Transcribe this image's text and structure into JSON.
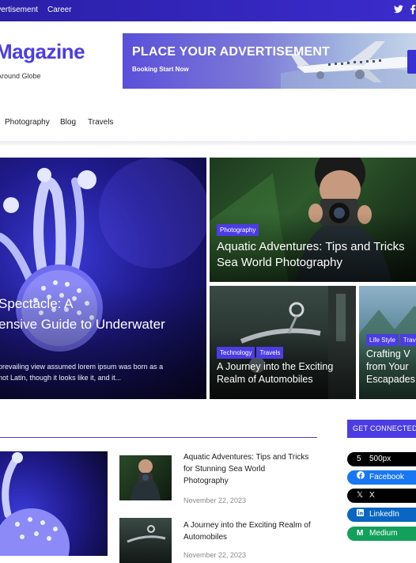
{
  "topbar": {
    "links": [
      "Advertisement",
      "Career"
    ],
    "social": [
      "twitter-icon",
      "facebook-icon"
    ]
  },
  "header": {
    "logo_text": "Magazine",
    "tagline": "Around Globe",
    "ad": {
      "title": "PLACE YOUR ADVERTISEMENT",
      "subtitle": "Booking Start Now"
    }
  },
  "nav": {
    "items": [
      "Photography",
      "Blog",
      "Travels"
    ]
  },
  "hero": {
    "main": {
      "title_line1": "Spectacle: A",
      "title_line2": "ensive Guide to Underwater",
      "excerpt_line1": "prevailing view assumed lorem ipsum was born as a",
      "excerpt_line2": "not Latin, though it looks like it, and it..."
    },
    "top_right": {
      "category": "Photography",
      "title_line1": "Aquatic Adventures: Tips and Tricks",
      "title_line2": "Sea World Photography"
    },
    "bottom_left": {
      "categories": [
        "Technology",
        "Travels"
      ],
      "title_line1": "A Journey into the Exciting",
      "title_line2": "Realm of Automobiles"
    },
    "bottom_right": {
      "categories": [
        "Life Style",
        "Travels"
      ],
      "title_line1": "Crafting V",
      "title_line2": "from Your",
      "title_line3": "Escapades"
    }
  },
  "posts": [
    {
      "title": "Aquatic Adventures: Tips and Tricks for Stunning Sea World Photography",
      "date": "November 22, 2023"
    },
    {
      "title": "A Journey into the Exciting Realm of Automobiles",
      "date": "November 22, 2023"
    }
  ],
  "sidebar": {
    "heading": "GET CONNECTED",
    "socials": [
      {
        "label": "500px",
        "icon": "500px-icon",
        "color": "#000000"
      },
      {
        "label": "Facebook",
        "icon": "facebook-icon",
        "color": "#1877f2"
      },
      {
        "label": "X",
        "icon": "x-icon",
        "color": "#000000"
      },
      {
        "label": "LinkedIn",
        "icon": "linkedin-icon",
        "color": "#0a66c2"
      },
      {
        "label": "Medium",
        "icon": "medium-icon",
        "color": "#12a05a"
      }
    ]
  },
  "colors": {
    "accent": "#4b3de3",
    "topbar": "#2a1fa8"
  }
}
